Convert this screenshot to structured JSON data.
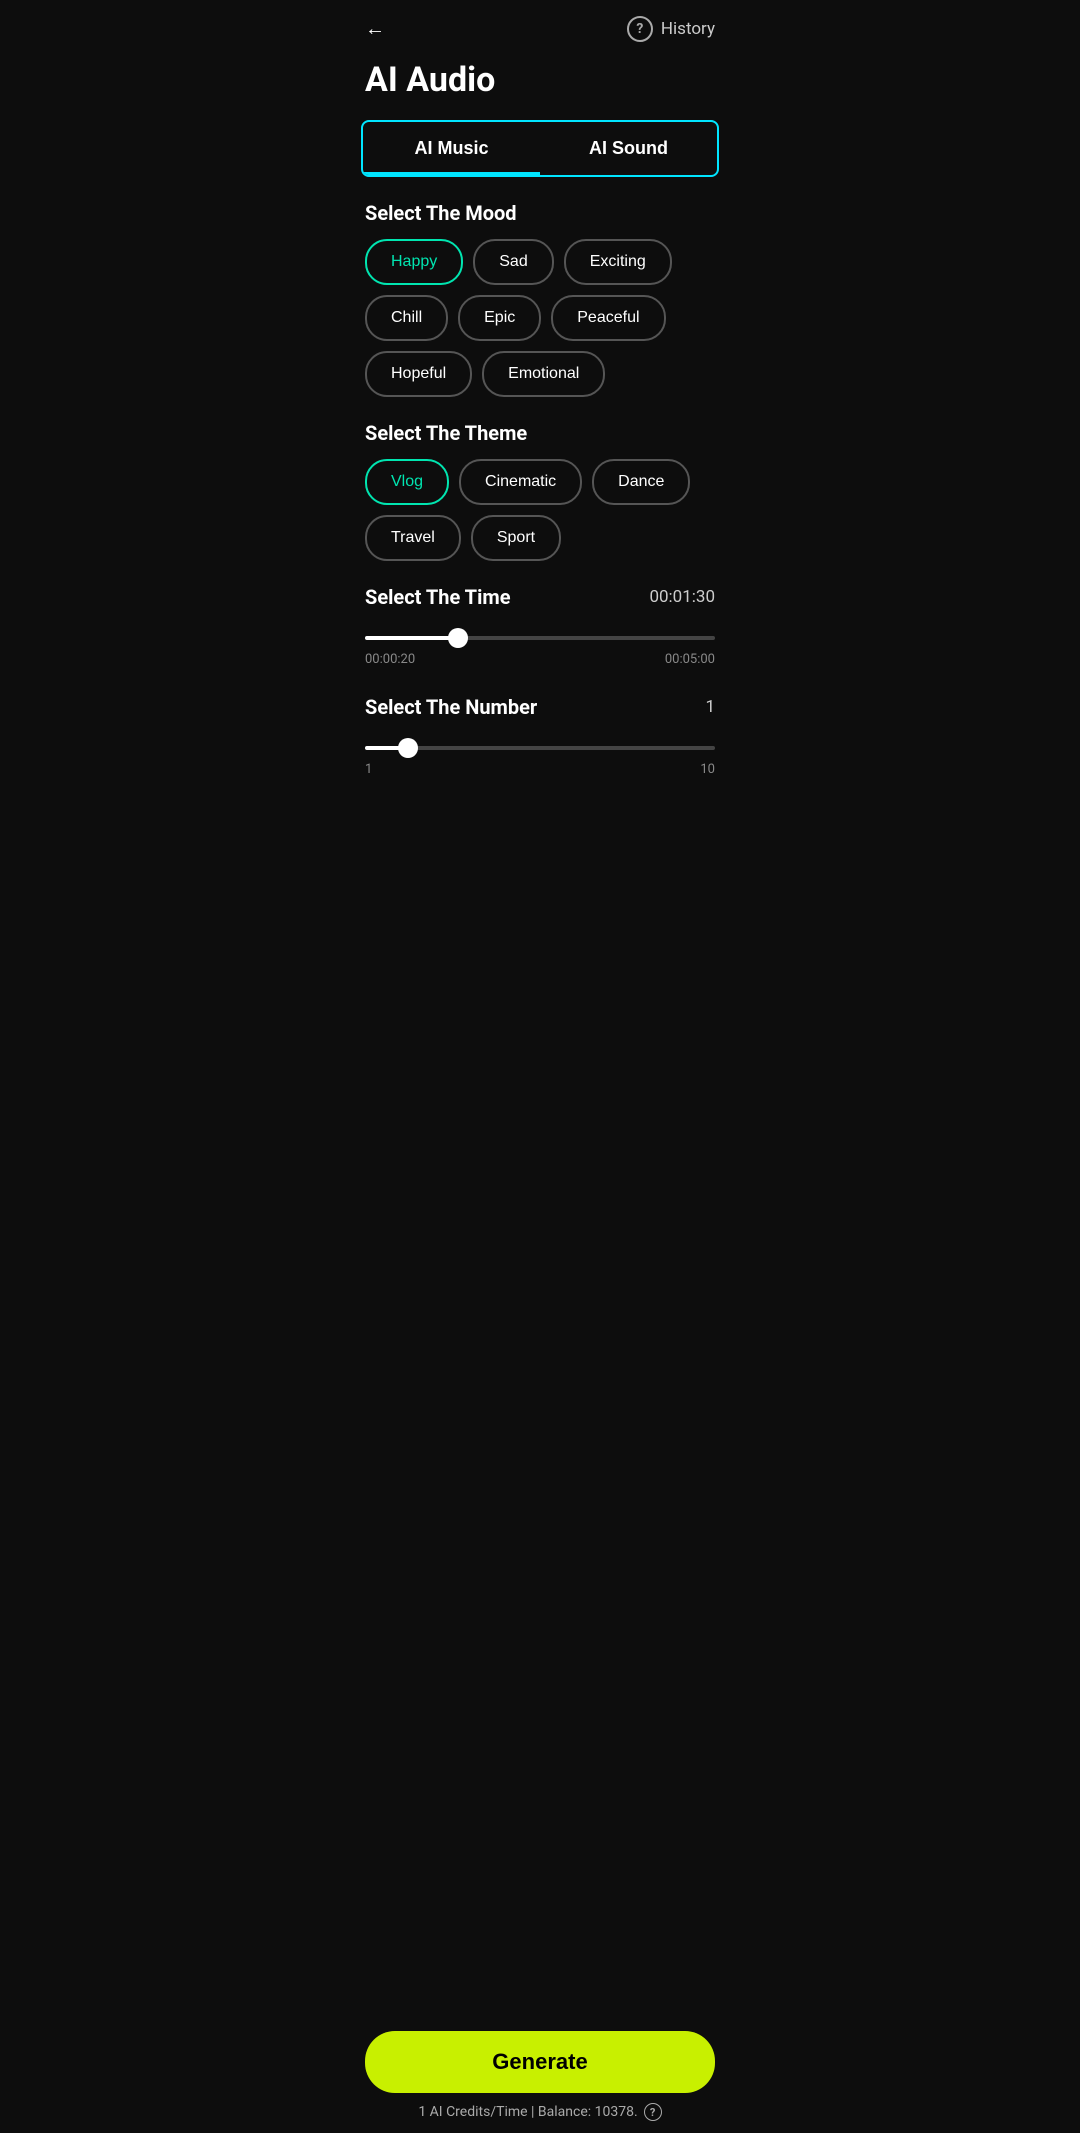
{
  "header": {
    "back_label": "←",
    "help_label": "?",
    "history_label": "History"
  },
  "page": {
    "title": "AI Audio"
  },
  "tabs": [
    {
      "id": "ai-music",
      "label": "AI Music",
      "active": true
    },
    {
      "id": "ai-sound",
      "label": "AI Sound",
      "active": false
    }
  ],
  "mood": {
    "section_title": "Select The Mood",
    "chips": [
      {
        "label": "Happy",
        "selected": true
      },
      {
        "label": "Sad",
        "selected": false
      },
      {
        "label": "Exciting",
        "selected": false
      },
      {
        "label": "Chill",
        "selected": false
      },
      {
        "label": "Epic",
        "selected": false
      },
      {
        "label": "Peaceful",
        "selected": false
      },
      {
        "label": "Hopeful",
        "selected": false
      },
      {
        "label": "Emotional",
        "selected": false
      }
    ]
  },
  "theme": {
    "section_title": "Select The Theme",
    "chips": [
      {
        "label": "Vlog",
        "selected": true
      },
      {
        "label": "Cinematic",
        "selected": false
      },
      {
        "label": "Dance",
        "selected": false
      },
      {
        "label": "Travel",
        "selected": false
      },
      {
        "label": "Sport",
        "selected": false
      }
    ]
  },
  "time_select": {
    "section_title": "Select The Time",
    "current_value": "00:01:30",
    "min_label": "00:00:20",
    "max_label": "00:05:00",
    "slider_percent": 25
  },
  "number_select": {
    "section_title": "Select The Number",
    "current_value": "1",
    "min_label": "1",
    "max_label": "10",
    "slider_percent": 10
  },
  "generate": {
    "button_label": "Generate"
  },
  "footer": {
    "credits_text": "1 AI Credits/Time | Balance: 10378.",
    "help_label": "?"
  }
}
